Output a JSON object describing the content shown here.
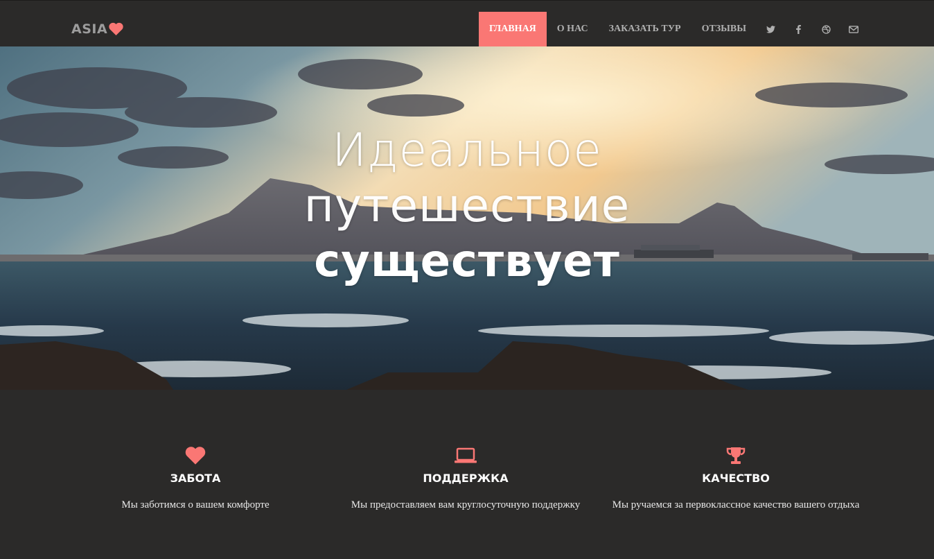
{
  "brand": {
    "name": "ASIA",
    "accent": "#fa7774",
    "icon": "heart-icon"
  },
  "nav": {
    "items": [
      {
        "label": "Главная",
        "active": true
      },
      {
        "label": "О нас",
        "active": false
      },
      {
        "label": "Заказать тур",
        "active": false
      },
      {
        "label": "Отзывы",
        "active": false
      }
    ],
    "social": [
      "twitter-icon",
      "facebook-icon",
      "dribbble-icon",
      "envelope-icon"
    ]
  },
  "hero": {
    "line1": "Идеальное",
    "line2": "путешествие",
    "line3": "существует"
  },
  "features": [
    {
      "icon": "heart-icon",
      "title": "Забота",
      "text": "Мы заботимся о вашем комфорте"
    },
    {
      "icon": "laptop-icon",
      "title": "Поддержка",
      "text": "Мы предоставляем вам круглосуточную поддержку"
    },
    {
      "icon": "trophy-icon",
      "title": "Качество",
      "text": "Мы ручаемся за первоклассное качество вашего отдыха"
    }
  ],
  "colors": {
    "background": "#2b2a29",
    "accent": "#fa7774",
    "text": "#ffffff"
  }
}
